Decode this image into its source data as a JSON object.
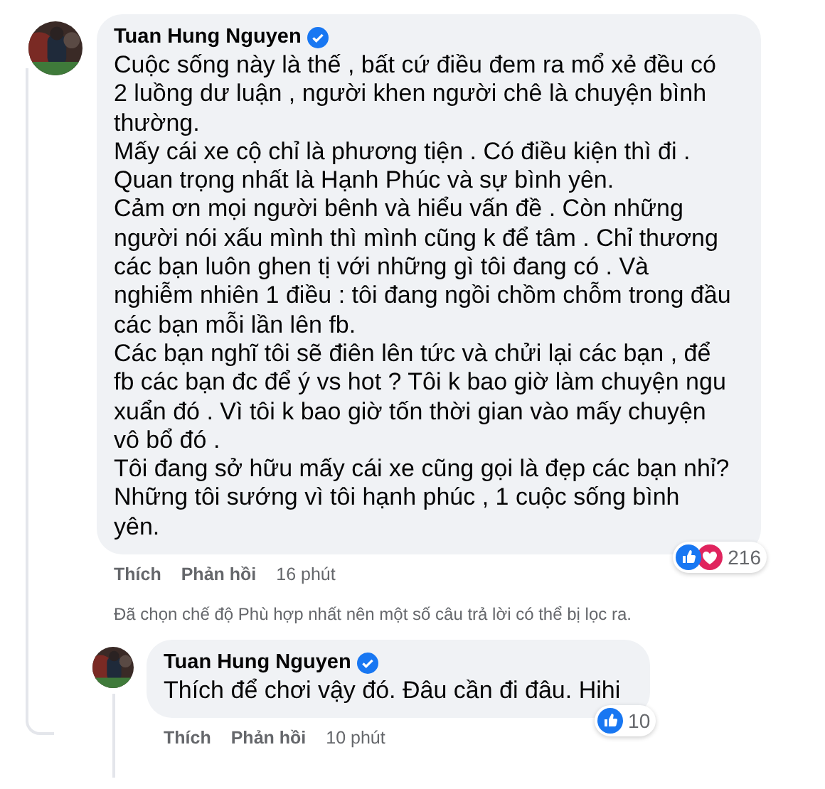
{
  "comment": {
    "author": "Tuan Hung Nguyen",
    "verified": true,
    "paragraphs": [
      "Cuộc sống này là thế , bất cứ điều đem ra mổ xẻ đều có 2 luồng dư luận , người khen người chê là chuyện bình thường.",
      "Mấy cái xe cộ chỉ là phương tiện . Có điều kiện thì đi .",
      "Quan trọng nhất là Hạnh Phúc và sự bình yên.",
      "Cảm ơn mọi người bênh và hiểu vấn đề . Còn những người nói xấu mình thì mình cũng k để tâm . Chỉ thương các bạn luôn ghen tị với những gì tôi đang có . Và nghiễm nhiên 1 điều : tôi đang ngồi chồm chỗm trong đầu các bạn mỗi lần lên fb.",
      "Các bạn nghĩ tôi sẽ điên lên tức và chửi lại các bạn , để fb các bạn đc để ý vs hot ? Tôi k bao giờ làm chuyện ngu xuẩn đó . Vì tôi k bao giờ tốn thời gian vào mấy chuyện vô bổ đó .",
      "Tôi đang sở hữu mấy cái xe cũng gọi là đẹp các bạn nhỉ?",
      "Những tôi sướng vì tôi hạnh phúc , 1 cuộc sống bình yên."
    ],
    "reactions": [
      {
        "kind": "like"
      },
      {
        "kind": "love"
      }
    ],
    "reaction_count": "216",
    "actions": [
      "Thích",
      "Phản hồi"
    ],
    "time": "16 phút",
    "notice": "Đã chọn chế độ Phù hợp nhất nên một số câu trả lời có thể bị lọc ra.",
    "replies": [
      {
        "author": "Tuan Hung Nguyen",
        "verified": true,
        "paragraphs": [
          "Thích để chơi vậy đó. Đâu cần đi đâu. Hihi"
        ],
        "reactions": [
          {
            "kind": "like"
          }
        ],
        "reaction_count": "10",
        "actions": [
          "Thích",
          "Phản hồi"
        ],
        "time": "10 phút"
      }
    ]
  }
}
